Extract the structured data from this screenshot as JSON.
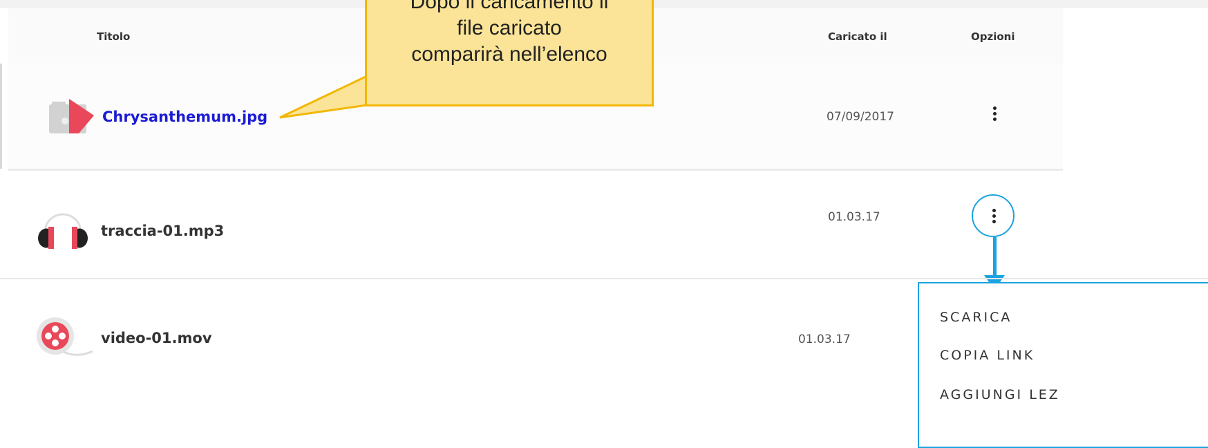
{
  "columns": {
    "title": "Titolo",
    "uploaded": "Caricato il",
    "options": "Opzioni"
  },
  "files": [
    {
      "name": "Chrysanthemum.jpg",
      "date": "07/09/2017",
      "icon": "image-file-icon",
      "highlighted": true
    },
    {
      "name": "traccia-01.mp3",
      "date": "01.03.17",
      "icon": "headphones-icon"
    },
    {
      "name": "video-01.mov",
      "date": "01.03.17",
      "icon": "video-reel-icon"
    }
  ],
  "callout": {
    "line1": "Dopo il caricamento il",
    "line2": "file caricato",
    "line3": "comparirà nell’elenco"
  },
  "menu": {
    "items": [
      "SCARICA",
      "COPIA LINK",
      "AGGIUNGI LEZ"
    ]
  },
  "colors": {
    "accent": "#1aa3e0",
    "callout_bg": "#fbe497",
    "callout_border": "#f2b705",
    "link": "#1b1bd6",
    "icon_red": "#e8485a"
  }
}
